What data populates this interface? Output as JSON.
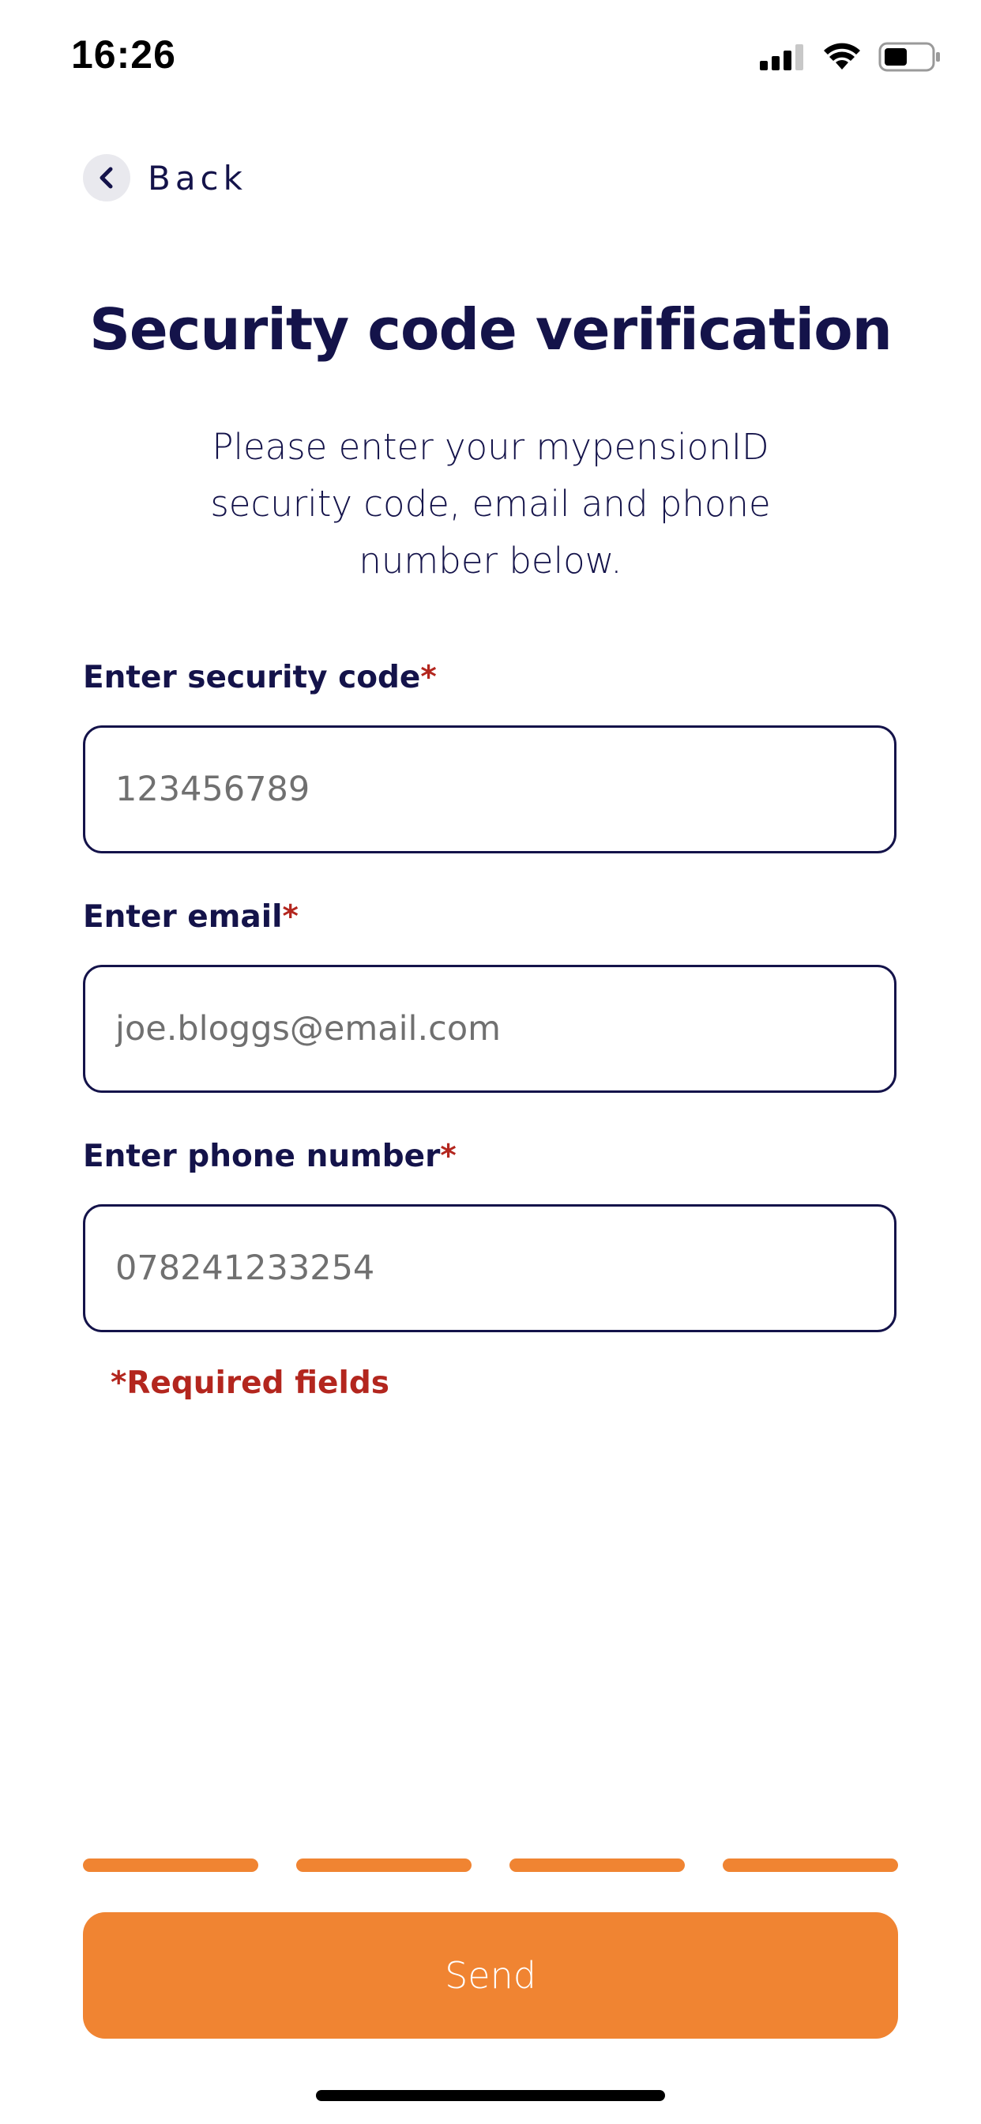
{
  "status_bar": {
    "time": "16:26",
    "icons": [
      "cellular-signal-icon",
      "wifi-icon",
      "battery-icon"
    ]
  },
  "nav": {
    "back_label": "Back",
    "back_icon": "chevron-left-icon"
  },
  "page": {
    "title": "Security code verification",
    "subtitle": "Please enter your mypensionID security code, email and phone number below."
  },
  "form": {
    "security_code": {
      "label": "Enter security code",
      "required_marker": "*",
      "placeholder": "123456789",
      "value": ""
    },
    "email": {
      "label": "Enter email",
      "required_marker": "*",
      "placeholder": "joe.bloggs@email.com",
      "value": ""
    },
    "phone": {
      "label": "Enter phone number",
      "required_marker": "*",
      "placeholder": "078241233254",
      "value": ""
    },
    "required_note": "*Required fields"
  },
  "progress": {
    "total_steps": 4,
    "completed_steps": 4
  },
  "actions": {
    "send_label": "Send"
  },
  "colors": {
    "primary_text": "#14134a",
    "accent": "#f08432",
    "required": "#b3261e",
    "placeholder": "#707070"
  }
}
